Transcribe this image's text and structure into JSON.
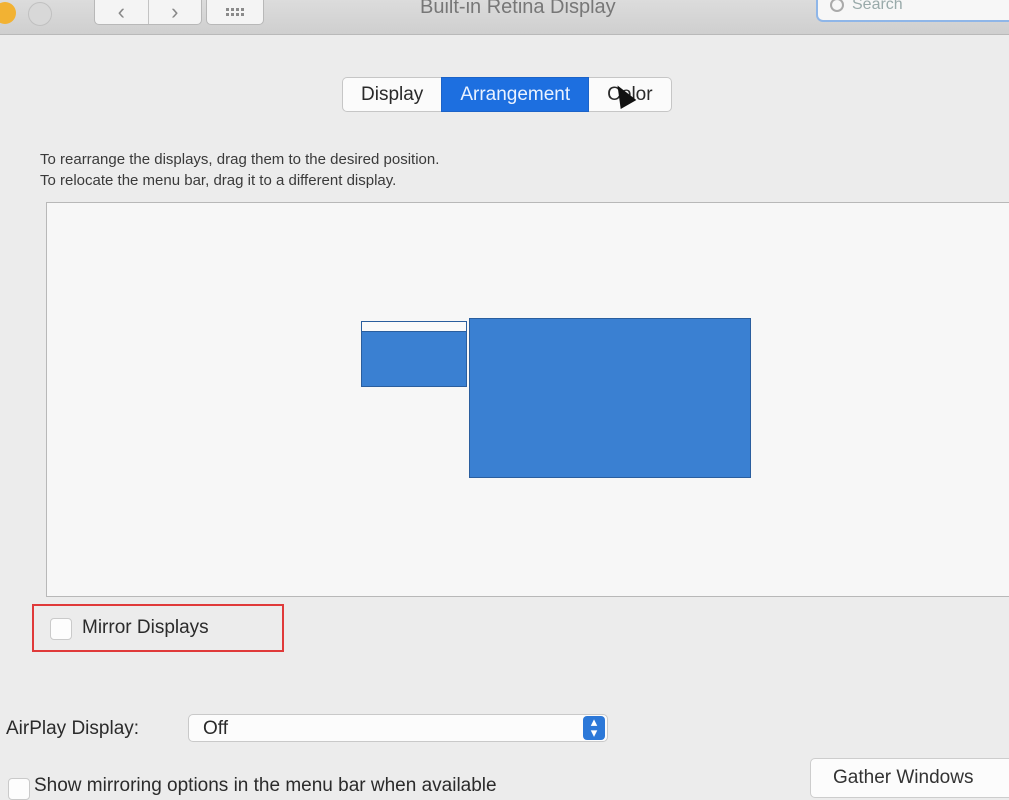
{
  "window": {
    "title": "Built-in Retina Display",
    "search_placeholder": "Search",
    "back_icon": "chevron-left",
    "forward_icon": "chevron-right",
    "grid_icon": "show-all-grid"
  },
  "tabs": [
    {
      "label": "Display",
      "active": false
    },
    {
      "label": "Arrangement",
      "active": true
    },
    {
      "label": "Color",
      "active": false
    }
  ],
  "instructions": [
    "To rearrange the displays, drag them to the desired position.",
    "To relocate the menu bar, drag it to a different display."
  ],
  "arrangement": {
    "display_color": "#3a80d2",
    "displays": [
      "secondary-display",
      "primary-display"
    ]
  },
  "mirror": {
    "label": "Mirror Displays",
    "checked": false
  },
  "airplay": {
    "label": "AirPlay Display:",
    "value": "Off"
  },
  "show_mirroring": {
    "label": "Show mirroring options in the menu bar when available",
    "checked": false
  },
  "gather_button": "Gather Windows",
  "colors": {
    "accent": "#1d6fe0",
    "highlight_box": "#e03a3a"
  }
}
